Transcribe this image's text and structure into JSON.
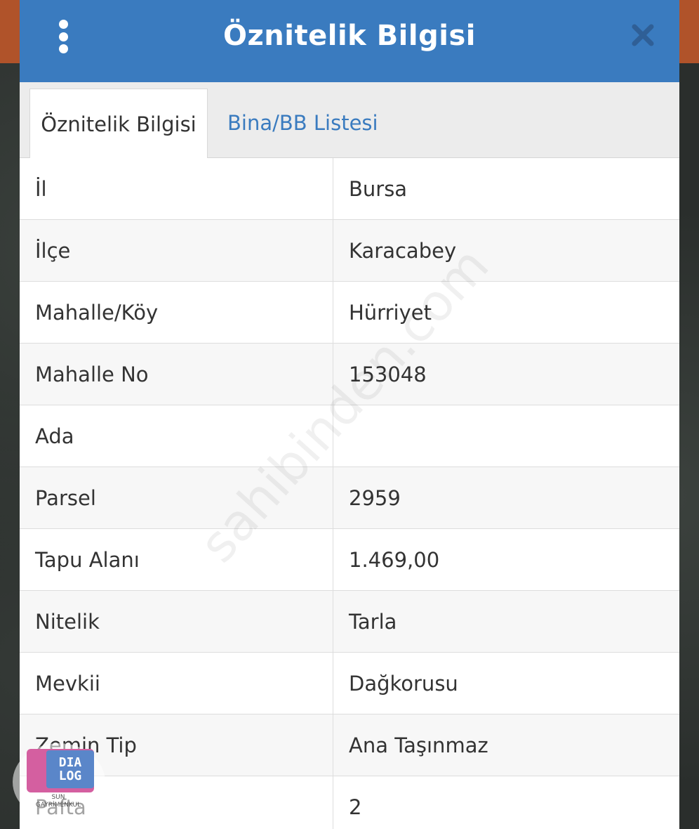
{
  "header": {
    "title": "Öznitelik Bilgisi"
  },
  "tabs": [
    {
      "label": "Öznitelik Bilgisi",
      "active": true
    },
    {
      "label": "Bina/BB Listesi",
      "active": false
    }
  ],
  "rows": [
    {
      "label": "İl",
      "value": "Bursa"
    },
    {
      "label": "İlçe",
      "value": "Karacabey"
    },
    {
      "label": "Mahalle/Köy",
      "value": "Hürriyet"
    },
    {
      "label": "Mahalle No",
      "value": "153048"
    },
    {
      "label": "Ada",
      "value": ""
    },
    {
      "label": "Parsel",
      "value": "2959"
    },
    {
      "label": "Tapu Alanı",
      "value": "1.469,00"
    },
    {
      "label": "Nitelik",
      "value": "Tarla"
    },
    {
      "label": "Mevkii",
      "value": "Dağkorusu"
    },
    {
      "label": "Zemin Tip",
      "value": "Ana Taşınmaz"
    },
    {
      "label": "Pafta",
      "value": "2"
    }
  ],
  "watermark": "sahibinden.com",
  "logo": {
    "line1": "DIA",
    "line2": "LOG",
    "sub1": "SUN",
    "sub2": "GAYRİMENKUL"
  },
  "colors": {
    "header_bg": "#3a7bbf",
    "tab_link": "#3a7bbf",
    "text": "#333333"
  }
}
